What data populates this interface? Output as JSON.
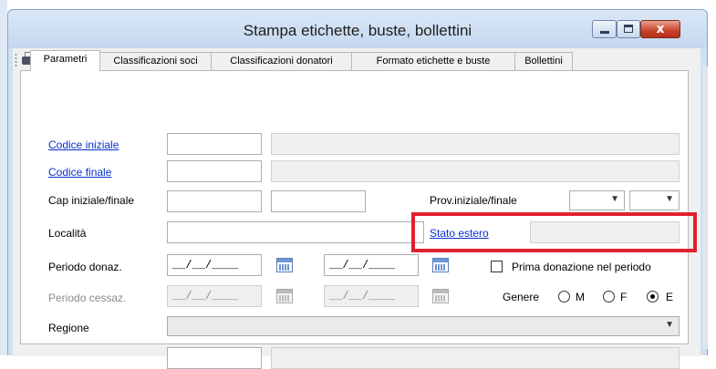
{
  "window": {
    "title": "Stampa etichette, buste, bollettini",
    "close_glyph": "x"
  },
  "toolbar": {
    "icons": [
      "printer-icon",
      "grid-icon",
      "undo-icon",
      "stop-icon"
    ],
    "stop_glyph": "0"
  },
  "tabs": [
    {
      "label": "Parametri",
      "active": true
    },
    {
      "label": "Classificazioni soci",
      "active": false
    },
    {
      "label": "Classificazioni donatori",
      "active": false
    },
    {
      "label": "Formato etichette e buste",
      "active": false
    },
    {
      "label": "Bollettini",
      "active": false
    }
  ],
  "form": {
    "codice_iniziale": {
      "label": "Codice iniziale",
      "code": "",
      "description": ""
    },
    "codice_finale": {
      "label": "Codice finale",
      "code": "",
      "description": ""
    },
    "cap": {
      "label": "Cap iniziale/finale",
      "from": "",
      "to": ""
    },
    "prov": {
      "label": "Prov.iniziale/finale",
      "from": "",
      "to": ""
    },
    "localita": {
      "label": "Località",
      "value": ""
    },
    "stato_estero": {
      "label": "Stato estero",
      "value": ""
    },
    "periodo_donaz": {
      "label": "Periodo donaz.",
      "from": "__/__/____",
      "to": "__/__/____"
    },
    "periodo_cessaz": {
      "label": "Periodo cessaz.",
      "from": "__/__/____",
      "to": "__/__/____"
    },
    "prima_donazione": {
      "label": "Prima donazione nel periodo",
      "checked": false
    },
    "genere": {
      "label": "Genere",
      "options": [
        "M",
        "F",
        "E"
      ],
      "selected": "E"
    },
    "regione": {
      "label": "Regione",
      "value": ""
    }
  },
  "colors": {
    "link": "#0a30d0",
    "highlight": "#e0212e",
    "close_button": "#c7412a"
  }
}
